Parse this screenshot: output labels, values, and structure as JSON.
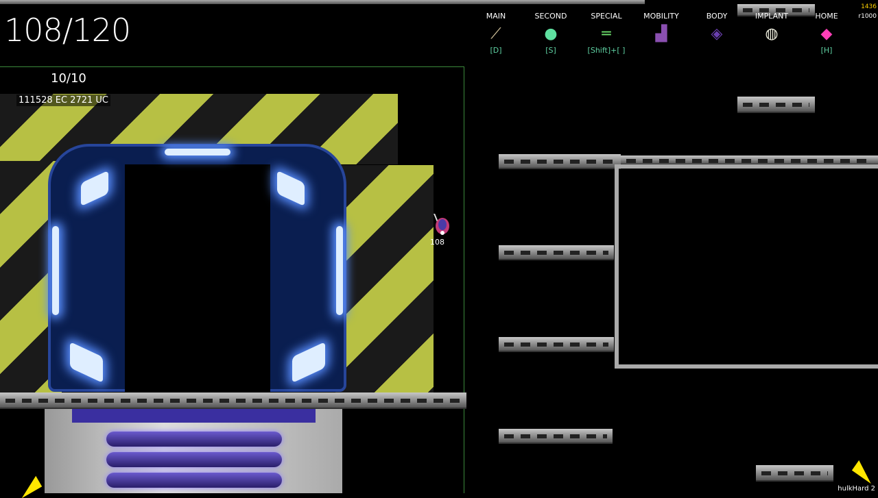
{
  "hud": {
    "health": "108/120",
    "energy": "10/10",
    "currency": "111528 EC  2721 UC",
    "player_hp": "108"
  },
  "equipment": [
    {
      "label": "MAIN",
      "icon": "spear-icon",
      "key": "[D]"
    },
    {
      "label": "SECOND",
      "icon": "orb-icon",
      "key": "[S]"
    },
    {
      "label": "SPECIAL",
      "icon": "dash-beam-icon",
      "key": "[Shift]+[ ]"
    },
    {
      "label": "MOBILITY",
      "icon": "boots-icon",
      "key": ""
    },
    {
      "label": "BODY",
      "icon": "armor-icon",
      "key": ""
    },
    {
      "label": "IMPLANT",
      "icon": "lantern-icon",
      "key": ""
    },
    {
      "label": "HOME",
      "icon": "pink-crystal-icon",
      "key": "[H]"
    }
  ],
  "corner": {
    "count": "1436",
    "limit": "r1000"
  },
  "mode": "hulkHard 2",
  "colors": {
    "hazard_yellow": "#b7c044",
    "energy_green": "#5fd1a3",
    "door_glow": "#5a8fff",
    "accent_yellow": "#ffd200"
  }
}
